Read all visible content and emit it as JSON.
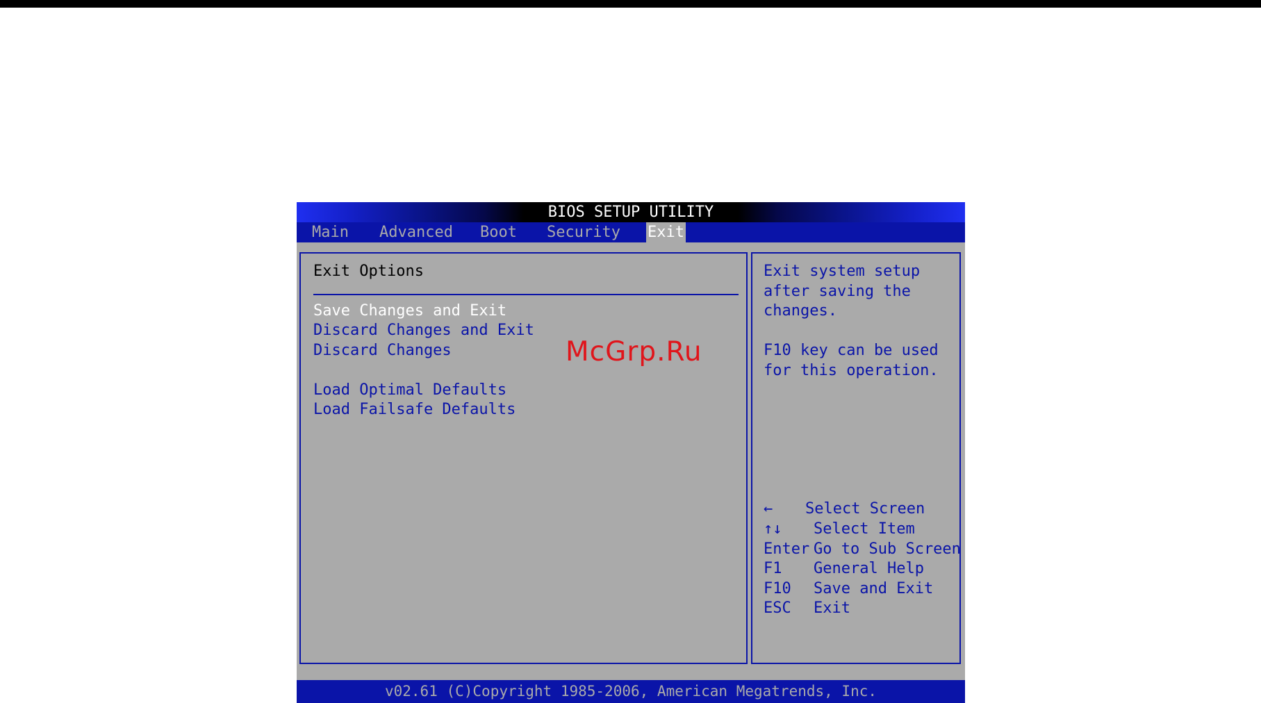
{
  "window": {
    "title": "BIOS SETUP UTILITY"
  },
  "menu": {
    "tabs": [
      {
        "label": "Main"
      },
      {
        "label": "Advanced"
      },
      {
        "label": "Boot"
      },
      {
        "label": "Security"
      },
      {
        "label": "Exit",
        "active": true
      }
    ]
  },
  "main": {
    "section_title": "Exit Options",
    "options": [
      {
        "label": "Save Changes and Exit",
        "selected": true
      },
      {
        "label": "Discard Changes and Exit"
      },
      {
        "label": "Discard Changes"
      },
      {
        "label": "Load Optimal Defaults"
      },
      {
        "label": "Load Failsafe Defaults"
      }
    ]
  },
  "help": {
    "lines": [
      "Exit system setup",
      "after saving the",
      "changes.",
      "F10 key can be used",
      "for this operation."
    ],
    "keys": [
      {
        "key": "←",
        "desc": "Select Screen"
      },
      {
        "key": "↑↓",
        "desc": "Select Item"
      },
      {
        "key": "Enter",
        "desc": "Go to Sub Screen"
      },
      {
        "key": "F1",
        "desc": "General Help"
      },
      {
        "key": "F10",
        "desc": "Save and Exit"
      },
      {
        "key": "ESC",
        "desc": "Exit"
      }
    ]
  },
  "footer": {
    "text": "v02.61 (C)Copyright 1985-2006, American Megatrends, Inc."
  },
  "watermark": {
    "text": "McGrp.Ru"
  },
  "colors": {
    "bios_blue": "#0a14a8",
    "panel_gray": "#aaaaaa",
    "selected_text": "#ffffff",
    "watermark_red": "#e0151b"
  }
}
